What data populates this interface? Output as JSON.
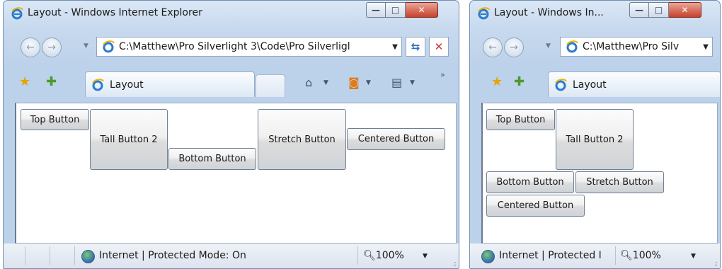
{
  "windows": [
    {
      "title": "Layout - Windows Internet Explorer",
      "address": "C:\\Matthew\\Pro Silverlight 3\\Code\\Pro Silverligl",
      "tab_label": "Layout",
      "buttons": {
        "top": "Top Button",
        "tall": "Tall Button 2",
        "bottom": "Bottom Button",
        "stretch": "Stretch Button",
        "centered": "Centered Button"
      },
      "status_text": "Internet | Protected Mode: On",
      "zoom": "100%"
    },
    {
      "title": "Layout - Windows In...",
      "address": "C:\\Matthew\\Pro Silv",
      "tab_label": "Layout",
      "buttons": {
        "top": "Top Button",
        "tall": "Tall Button 2",
        "bottom": "Bottom Button",
        "stretch": "Stretch Button",
        "centered": "Centered Button"
      },
      "status_text": "Internet | Protected I",
      "zoom": "100%"
    }
  ],
  "icons": {
    "ie_logo": "ie-logo-icon",
    "favorites": "favorites-star-icon",
    "add_favorites": "add-favorites-icon",
    "home": "home-icon",
    "feeds": "rss-feed-icon",
    "print": "print-icon",
    "refresh": "refresh-icon",
    "stop": "stop-icon",
    "zoom": "zoom-magnifier-icon",
    "internet": "globe-icon"
  },
  "colors": {
    "frame": "#c7d9ee",
    "close_button": "#c8412c",
    "content_bg": "#ffffff"
  }
}
